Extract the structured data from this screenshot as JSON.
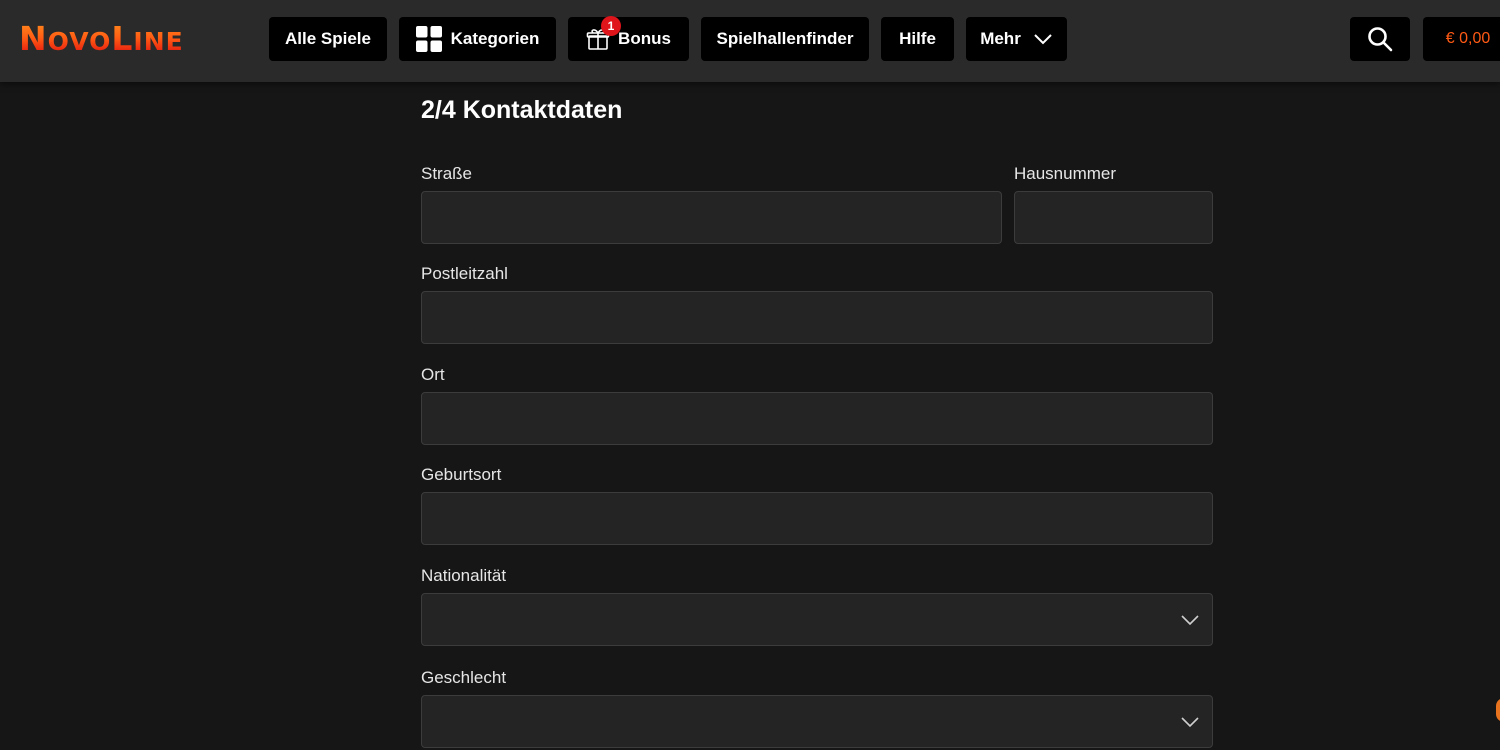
{
  "brand": {
    "logo_first": "N",
    "logo_mid": "OVO",
    "logo_second": "L",
    "logo_end": "INE"
  },
  "nav": {
    "all_games": "Alle Spiele",
    "categories": "Kategorien",
    "bonus": "Bonus",
    "bonus_badge": "1",
    "arcade_finder": "Spielhallenfinder",
    "help": "Hilfe",
    "more": "Mehr"
  },
  "account": {
    "balance": "€ 0,00"
  },
  "form": {
    "title": "2/4 Kontaktdaten",
    "street": {
      "label": "Straße",
      "value": ""
    },
    "house_number": {
      "label": "Hausnummer",
      "value": ""
    },
    "postal_code": {
      "label": "Postleitzahl",
      "value": ""
    },
    "city": {
      "label": "Ort",
      "value": ""
    },
    "birthplace": {
      "label": "Geburtsort",
      "value": ""
    },
    "nationality": {
      "label": "Nationalität",
      "selected": ""
    },
    "gender": {
      "label": "Geschlecht",
      "selected": ""
    }
  },
  "colors": {
    "accent": "#ff5a14",
    "badge": "#e0141b",
    "header_bg": "#2a2a2a",
    "page_bg": "#161616",
    "field_bg": "#242424"
  }
}
